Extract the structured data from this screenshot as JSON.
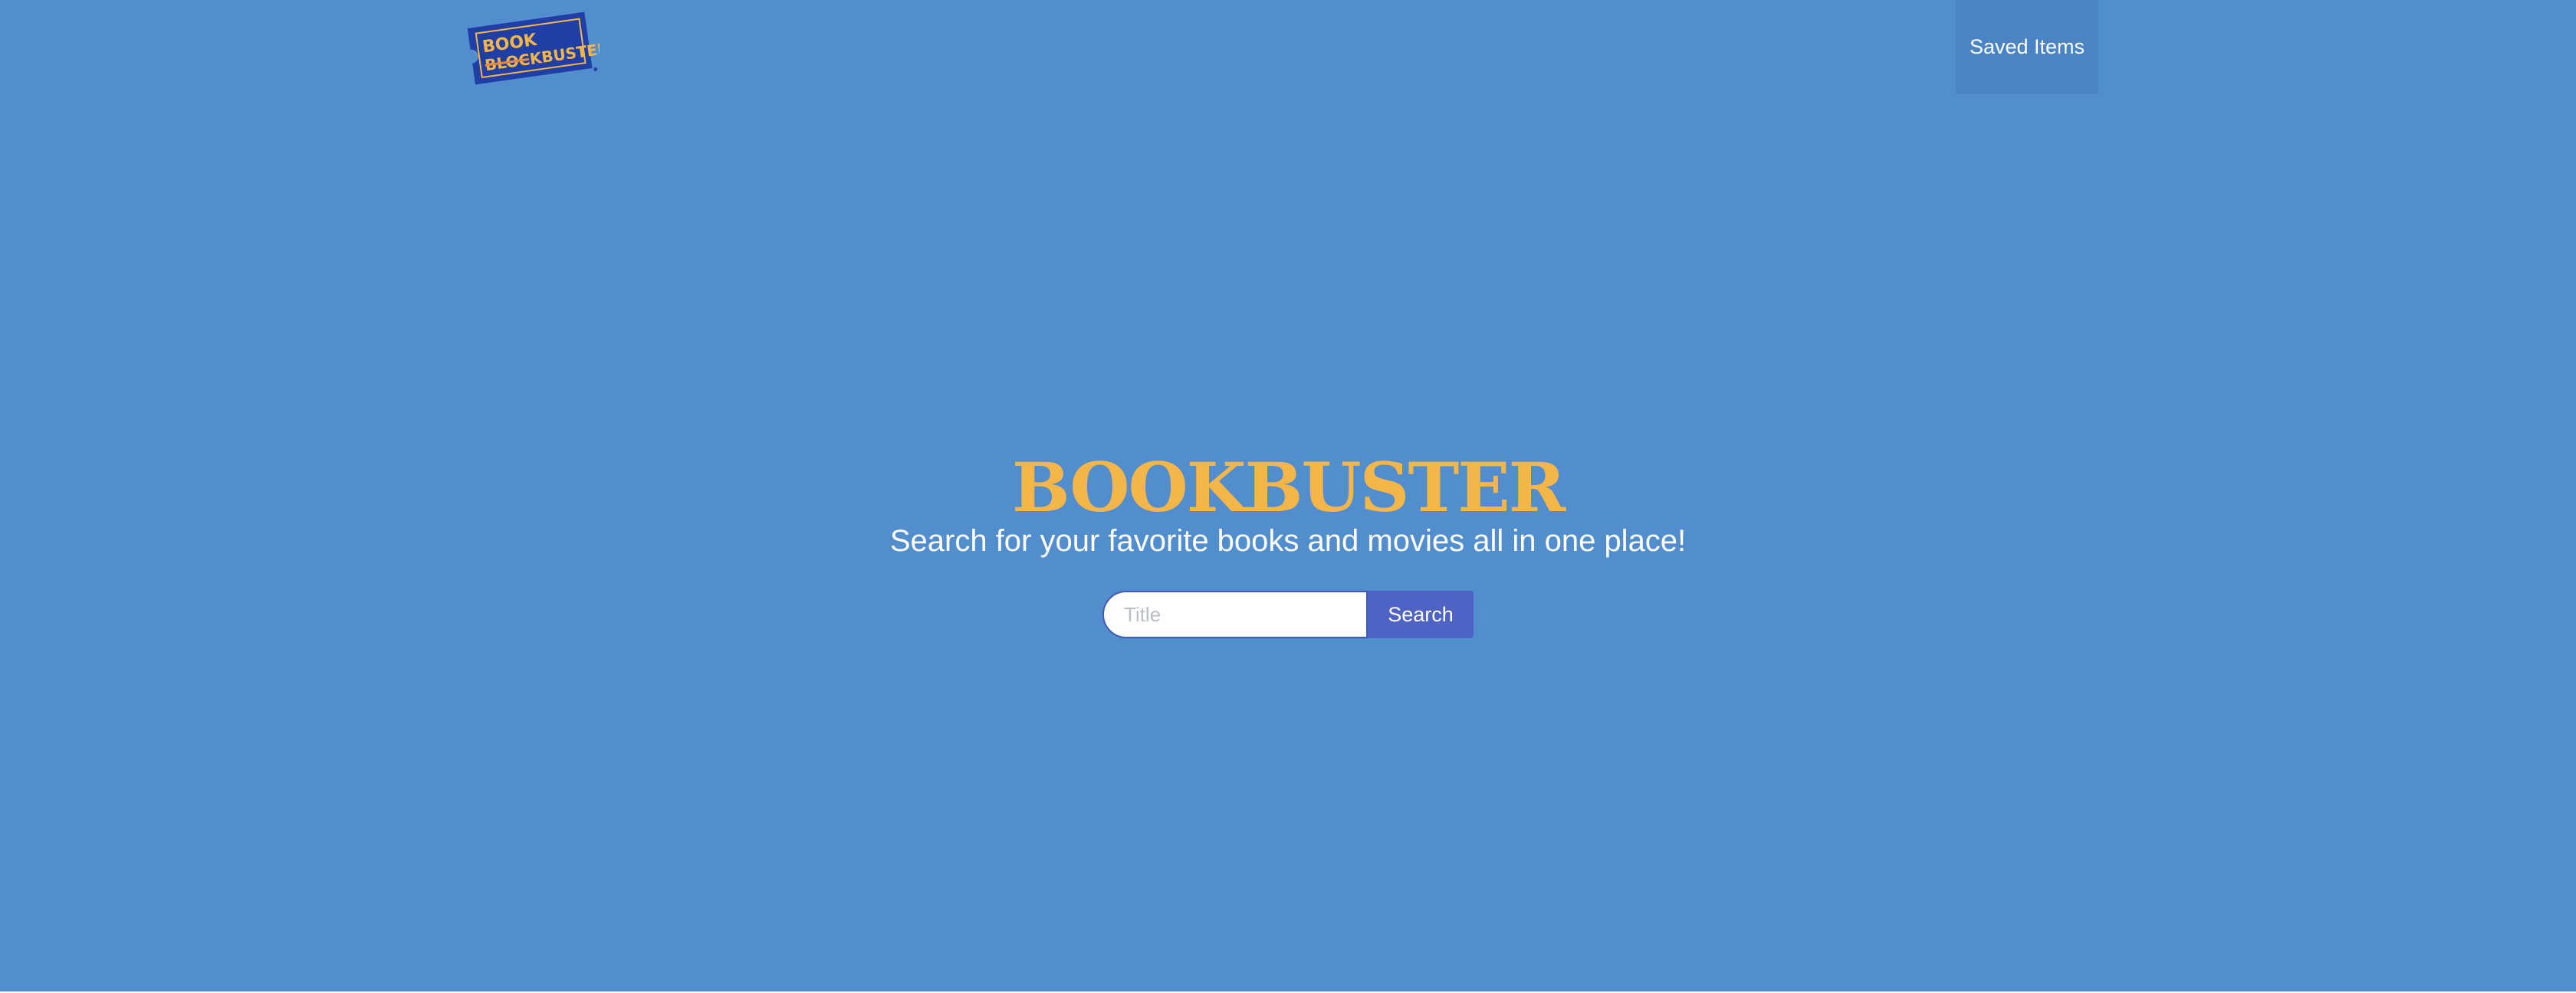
{
  "navbar": {
    "logo": {
      "text_line1": "BOOK",
      "text_line2": "BLOCKBUSTER"
    },
    "saved_items_label": "Saved Items"
  },
  "hero": {
    "title": "BOOKBUSTER",
    "tagline": "Search for your favorite books and movies all in one place!"
  },
  "search": {
    "placeholder": "Title",
    "value": "",
    "button_label": "Search"
  },
  "colors": {
    "background": "#528dcd",
    "brand_yellow": "#f4b648",
    "logo_blue": "#1f3fa6",
    "button": "#4f63c4",
    "nav_hover": "#4a84c4"
  }
}
